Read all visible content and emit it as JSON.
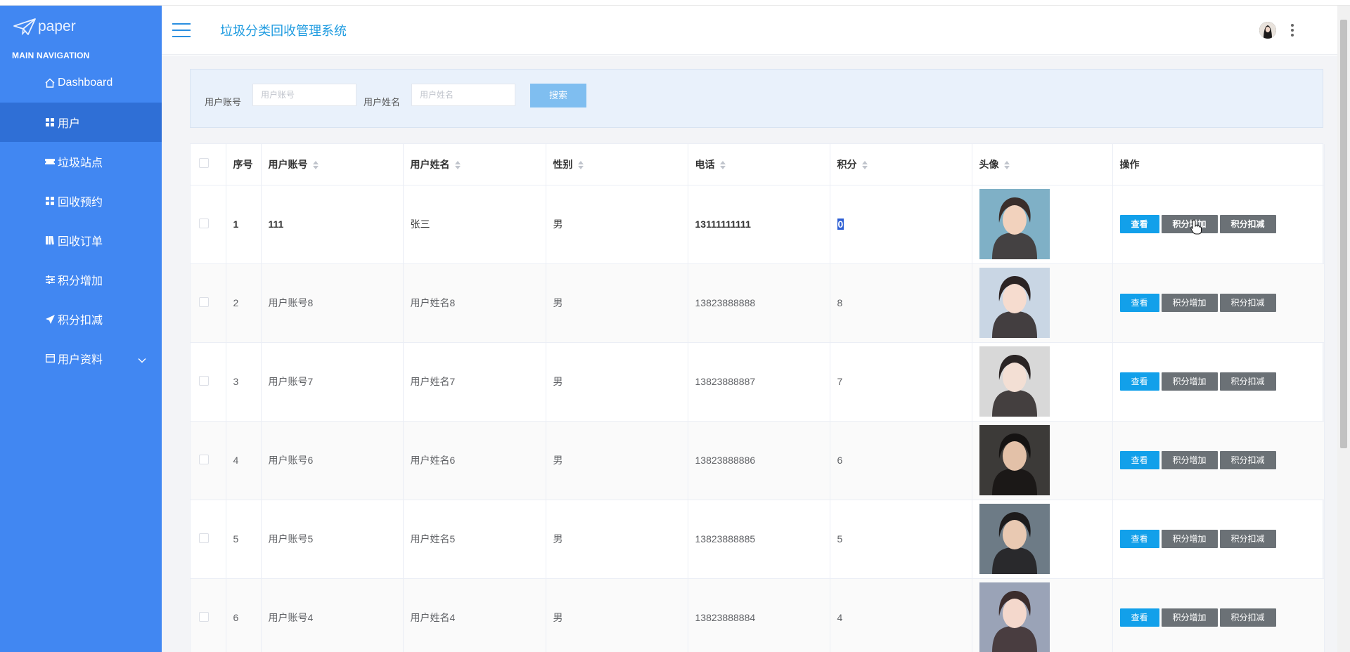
{
  "app": {
    "logo_text": "paper",
    "title": "垃圾分类回收管理系统"
  },
  "sidebar": {
    "header": "MAIN NAVIGATION",
    "items": [
      {
        "label": "Dashboard",
        "icon": "home-icon"
      },
      {
        "label": "用户",
        "icon": "grid-icon"
      },
      {
        "label": "垃圾站点",
        "icon": "ticket-icon"
      },
      {
        "label": "回收预约",
        "icon": "grid-icon"
      },
      {
        "label": "回收订单",
        "icon": "book-icon"
      },
      {
        "label": "积分增加",
        "icon": "sliders-icon"
      },
      {
        "label": "积分扣减",
        "icon": "send-icon"
      },
      {
        "label": "用户资料",
        "icon": "calendar-icon"
      }
    ]
  },
  "search": {
    "account_label": "用户账号",
    "account_placeholder": "用户账号",
    "name_label": "用户姓名",
    "name_placeholder": "用户姓名",
    "button": "搜索"
  },
  "table": {
    "headers": [
      "序号",
      "用户账号",
      "用户姓名",
      "性别",
      "电话",
      "积分",
      "头像",
      "操作"
    ],
    "rows": [
      {
        "index": "1",
        "account": "111",
        "name": "张三",
        "gender": "男",
        "phone": "13111111111",
        "points": "0"
      },
      {
        "index": "2",
        "account": "用户账号8",
        "name": "用户姓名8",
        "gender": "男",
        "phone": "13823888888",
        "points": "8"
      },
      {
        "index": "3",
        "account": "用户账号7",
        "name": "用户姓名7",
        "gender": "男",
        "phone": "13823888887",
        "points": "7"
      },
      {
        "index": "4",
        "account": "用户账号6",
        "name": "用户姓名6",
        "gender": "男",
        "phone": "13823888886",
        "points": "6"
      },
      {
        "index": "5",
        "account": "用户账号5",
        "name": "用户姓名5",
        "gender": "男",
        "phone": "13823888885",
        "points": "5"
      },
      {
        "index": "6",
        "account": "用户账号4",
        "name": "用户姓名4",
        "gender": "男",
        "phone": "13823888884",
        "points": "4"
      }
    ],
    "actions": {
      "view": "查看",
      "add_points": "积分增加",
      "deduct_points": "积分扣减"
    }
  },
  "colors": {
    "sidebar": "#4187f2",
    "sidebar_active": "#2f6fd6",
    "title": "#1e9be0",
    "view_button": "#12a0ea",
    "gray_button": "#6b7176",
    "search_button": "#7fbef0"
  }
}
